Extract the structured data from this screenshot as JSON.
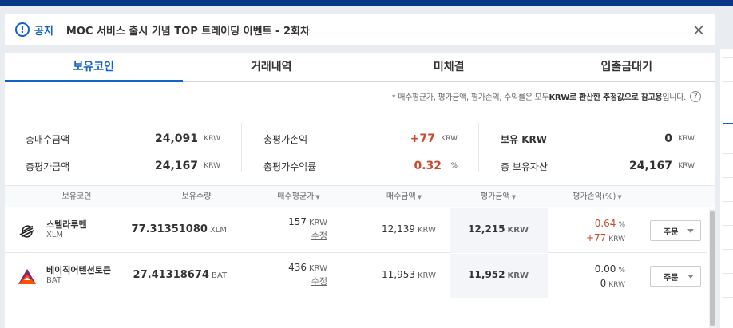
{
  "notice": {
    "label": "공지",
    "title": "MOC 서비스 출시 기념 TOP 트레이딩 이벤트 - 2회차",
    "close": "×"
  },
  "tabs": [
    {
      "label": "보유코인",
      "active": true
    },
    {
      "label": "거래내역",
      "active": false
    },
    {
      "label": "미체결",
      "active": false
    },
    {
      "label": "입출금대기",
      "active": false
    }
  ],
  "note": {
    "part1": "* 매수평균가, 평가금액, 평가손익, 수익률은 모두 ",
    "bold1": "KRW로 환산한 추정값으로 참고용",
    "part2": "입니다.",
    "help": "?"
  },
  "summary": {
    "total_buy": {
      "label": "총매수금액",
      "value": "24,091",
      "unit": "KRW"
    },
    "total_eval": {
      "label": "총평가금액",
      "value": "24,167",
      "unit": "KRW"
    },
    "total_pl": {
      "label": "총평가손익",
      "value": "+77",
      "unit": "KRW"
    },
    "total_return": {
      "label": "총평가수익률",
      "value": "0.32",
      "unit": "%"
    },
    "krw_held": {
      "label": "보유 KRW",
      "value": "0",
      "unit": "KRW"
    },
    "total_assets": {
      "label": "총 보유자산",
      "value": "24,167",
      "unit": "KRW"
    }
  },
  "table": {
    "headers": {
      "coin": "보유코인",
      "qty": "보유수량",
      "avg": "매수평균가",
      "buy": "매수금액",
      "eval": "평가금액",
      "pl": "평가손익(%)"
    },
    "rows": [
      {
        "name": "스텔라루멘",
        "symbol": "XLM",
        "qty": "77.31351080",
        "qty_unit": "XLM",
        "avg": "157",
        "avg_unit": "KRW",
        "edit": "수정",
        "buy": "12,139",
        "buy_unit": "KRW",
        "eval": "12,215",
        "eval_unit": "KRW",
        "pl_rate": "0.64",
        "pl_rate_unit": "%",
        "pl_amount": "+77",
        "pl_amount_unit": "KRW",
        "order": "주문",
        "pl_color": "#c84a31"
      },
      {
        "name": "베이직어텐션토큰",
        "symbol": "BAT",
        "qty": "27.41318674",
        "qty_unit": "BAT",
        "avg": "436",
        "avg_unit": "KRW",
        "edit": "수정",
        "buy": "11,953",
        "buy_unit": "KRW",
        "eval": "11,952",
        "eval_unit": "KRW",
        "pl_rate": "0.00",
        "pl_rate_unit": "%",
        "pl_amount": "0",
        "pl_amount_unit": "KRW",
        "order": "주문",
        "pl_color": "#333333"
      }
    ]
  },
  "colors": {
    "brand": "#093687",
    "accent": "#1261c4",
    "rise": "#c84a31"
  }
}
